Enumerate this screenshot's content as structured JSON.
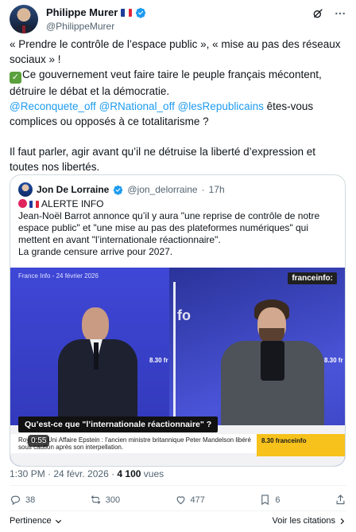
{
  "author": {
    "name": "Philippe Murer",
    "handle": "@PhilippeMurer"
  },
  "tweet": {
    "line1": "« Prendre le contrôle de l’espace public », « mise au pas des réseaux sociaux » !",
    "line2": "Ce gouvernement veut faire taire le peuple français mécontent, détruire le débat et la démocratie.",
    "mention1": "@Reconquete_off",
    "mention2": "@RNational_off",
    "mention3": "@lesRepublicains",
    "line3_rest": " êtes-vous complices ou opposés à ce totalitarisme ?",
    "line4": "Il faut parler, agir avant qu’il ne détruise la liberté d’expression et toutes nos libertés."
  },
  "quote": {
    "name": "Jon De Lorraine",
    "handle": "@jon_delorraine",
    "time": "17h",
    "alert": "ALERTE INFO",
    "body1": "Jean-Noël Barrot annonce qu’il y aura \"une reprise de contrôle de notre espace public\" et \"une mise au pas des plateformes numériques\" qui mettent en avant \"l’internationale réactionnaire\".",
    "body2": "La grande censure arrive pour 2027.",
    "video": {
      "top_left": "France Info - 24 février 2026",
      "logo": "franceinfo:",
      "time_tag_left": "8.30 fr",
      "time_tag_right": "8.30 fr",
      "caption": "Qu’est-ce que \"l’internationale réactionnaire\" ?",
      "ticker": "Royaume-Uni Affaire Epstein : l’ancien ministre britannique Peter Mandelson libéré sous caution après son interpellation.",
      "ticker_tag": "8.30 franceinfo",
      "timer": "0:55"
    }
  },
  "meta": {
    "time": "1:30 PM · 24 févr. 2026 · ",
    "views_count": "4 100",
    "views_label": " vues"
  },
  "actions": {
    "replies": "38",
    "reposts": "300",
    "likes": "477",
    "bookmarks": "6"
  },
  "footer": {
    "left": "Pertinence",
    "right": "Voir les citations"
  },
  "colors": {
    "accent": "#1d9bf0",
    "text": "#0f1419",
    "muted": "#536471",
    "check": "#5aa03c"
  }
}
